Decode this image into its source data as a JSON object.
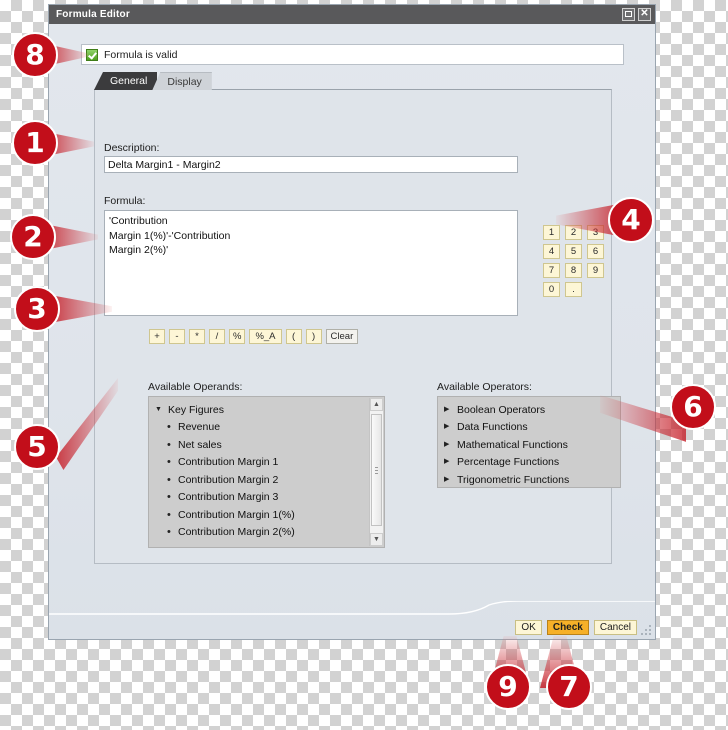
{
  "window": {
    "title": "Formula Editor",
    "controls": {
      "maximize": "maximize-icon",
      "close": "close-icon"
    }
  },
  "status": {
    "checkbox_state": "checked",
    "message": "Formula is valid"
  },
  "tabs": [
    {
      "label": "General",
      "active": true
    },
    {
      "label": "Display",
      "active": false
    }
  ],
  "description": {
    "label": "Description:",
    "value": "Delta Margin1 - Margin2",
    "placeholder": ""
  },
  "formula": {
    "label": "Formula:",
    "value": "'Contribution\nMargin 1(%)'-'Contribution\nMargin 2(%)'"
  },
  "keypad": {
    "keys": [
      "1",
      "2",
      "3",
      "4",
      "5",
      "6",
      "7",
      "8",
      "9",
      "0",
      "."
    ]
  },
  "operator_buttons": [
    {
      "label": "+",
      "style": "key"
    },
    {
      "label": "-",
      "style": "key"
    },
    {
      "label": "*",
      "style": "key"
    },
    {
      "label": "/",
      "style": "key"
    },
    {
      "label": "%",
      "style": "key"
    },
    {
      "label": "%_A",
      "style": "key-wide"
    },
    {
      "label": "(",
      "style": "key"
    },
    {
      "label": ")",
      "style": "key"
    },
    {
      "label": "Clear",
      "style": "clear"
    }
  ],
  "operands": {
    "label": "Available Operands:",
    "root": {
      "label": "Key Figures",
      "expanded": true
    },
    "items": [
      "Revenue",
      "Net sales",
      "Contribution Margin 1",
      "Contribution Margin 2",
      "Contribution Margin 3",
      "Contribution Margin 1(%)",
      "Contribution Margin 2(%)"
    ],
    "scrollbar": {
      "up": "scroll-up-arrow",
      "down": "scroll-down-arrow"
    }
  },
  "operators": {
    "label": "Available Operators:",
    "items": [
      "Boolean Operators",
      "Data Functions",
      "Mathematical Functions",
      "Percentage Functions",
      "Trigonometric Functions"
    ]
  },
  "footer": {
    "ok": "OK",
    "check": "Check",
    "cancel": "Cancel"
  },
  "callouts": {
    "c1": "1",
    "c2": "2",
    "c3": "3",
    "c4": "4",
    "c5": "5",
    "c6": "6",
    "c7": "7",
    "c8": "8",
    "c9": "9"
  },
  "colors": {
    "badge_red": "#c20e1a",
    "titlebar": "#59595b",
    "window_bg": "#dde3ea",
    "button_yellow": "#fdf6d6",
    "check_highlight": "#f6b028",
    "valid_green": "#4fa01f"
  }
}
